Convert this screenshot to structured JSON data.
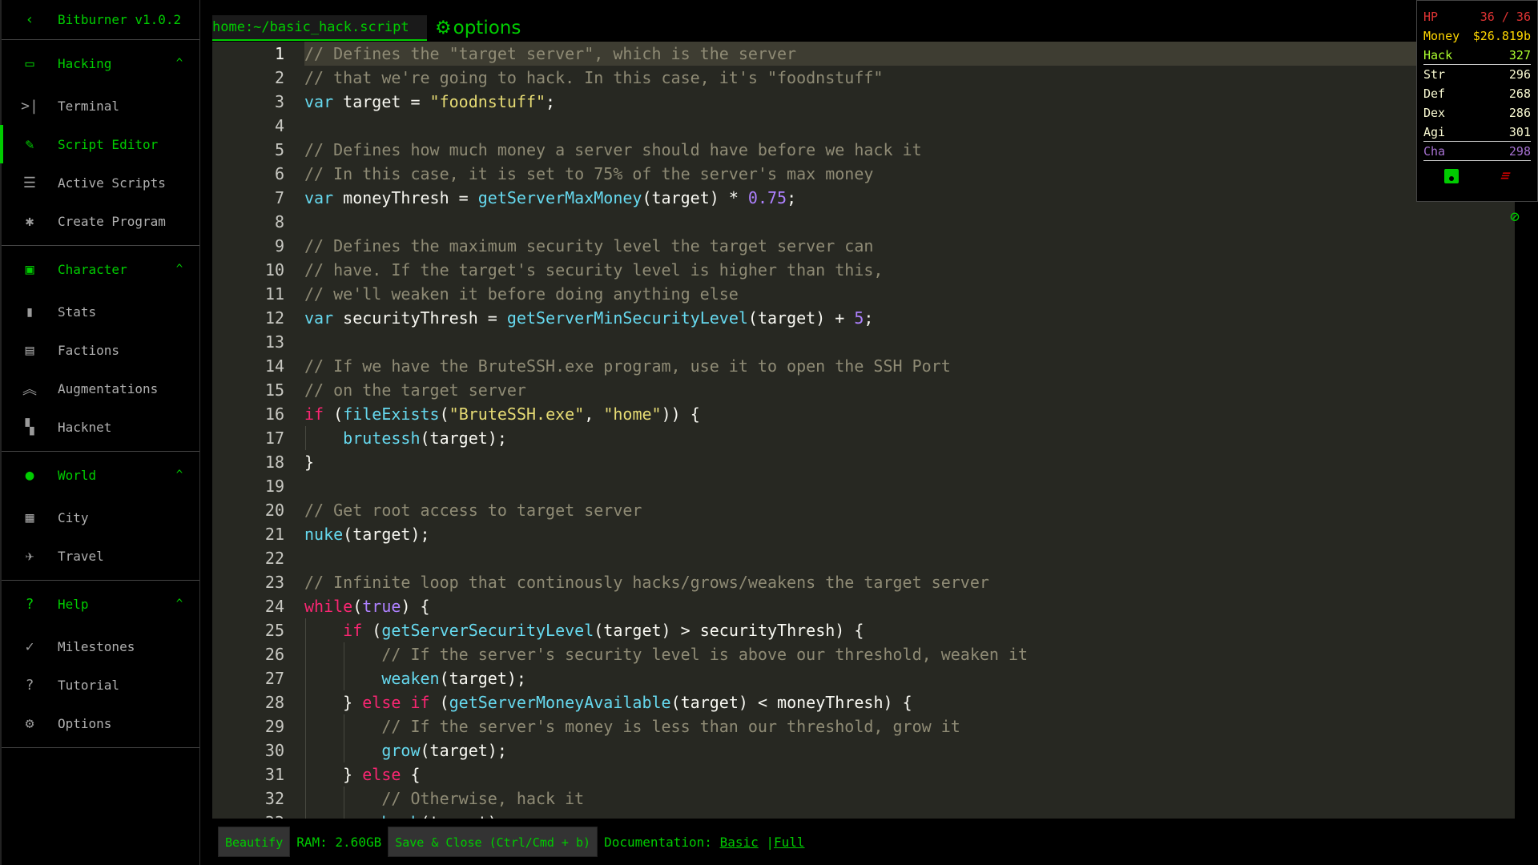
{
  "app": {
    "title": "Bitburner v1.0.2",
    "accent": "#00cc00"
  },
  "sidebar": {
    "sections": [
      {
        "label": "Hacking",
        "icon": "laptop-icon",
        "items": [
          {
            "label": "Terminal",
            "icon": "terminal-icon"
          },
          {
            "label": "Script Editor",
            "icon": "pencil-icon",
            "active": true
          },
          {
            "label": "Active Scripts",
            "icon": "list-icon"
          },
          {
            "label": "Create Program",
            "icon": "bug-icon"
          }
        ]
      },
      {
        "label": "Character",
        "icon": "account-box-icon",
        "items": [
          {
            "label": "Stats",
            "icon": "bar-chart-icon"
          },
          {
            "label": "Factions",
            "icon": "contacts-icon"
          },
          {
            "label": "Augmentations",
            "icon": "double-arrow-up-icon"
          },
          {
            "label": "Hacknet",
            "icon": "tree-icon"
          }
        ]
      },
      {
        "label": "World",
        "icon": "globe-icon",
        "items": [
          {
            "label": "City",
            "icon": "city-icon"
          },
          {
            "label": "Travel",
            "icon": "airplane-icon"
          }
        ]
      },
      {
        "label": "Help",
        "icon": "live-help-icon",
        "items": [
          {
            "label": "Milestones",
            "icon": "check-icon"
          },
          {
            "label": "Tutorial",
            "icon": "help-circle-icon"
          },
          {
            "label": "Options",
            "icon": "gear-icon"
          }
        ]
      }
    ]
  },
  "editor": {
    "tab": "home:~/basic_hack.script",
    "options_label": "options",
    "lines": [
      [
        [
          "c",
          "// Defines the \"target server\", which is the server"
        ]
      ],
      [
        [
          "c",
          "// that we're going to hack. In this case, it's \"foodnstuff\""
        ]
      ],
      [
        [
          "k",
          "var"
        ],
        [
          "",
          "target = "
        ],
        [
          "s",
          "\"foodnstuff\""
        ],
        [
          "",
          ";"
        ]
      ],
      [],
      [
        [
          "c",
          "// Defines how much money a server should have before we hack it"
        ]
      ],
      [
        [
          "c",
          "// In this case, it is set to 75% of the server's max money"
        ]
      ],
      [
        [
          "k",
          "var"
        ],
        [
          "",
          " moneyThresh = "
        ],
        [
          "f",
          "getServerMaxMoney"
        ],
        [
          "",
          "(target) * "
        ],
        [
          "n",
          "0.75"
        ],
        [
          "",
          ";"
        ]
      ],
      [],
      [
        [
          "c",
          "// Defines the maximum security level the target server can"
        ]
      ],
      [
        [
          "c",
          "// have. If the target's security level is higher than this,"
        ]
      ],
      [
        [
          "c",
          "// we'll weaken it before doing anything else"
        ]
      ],
      [
        [
          "k",
          "var"
        ],
        [
          "",
          " securityThresh = "
        ],
        [
          "f",
          "getServerMinSecurityLevel"
        ],
        [
          "",
          "(target) + "
        ],
        [
          "n",
          "5"
        ],
        [
          "",
          ";"
        ]
      ],
      [],
      [
        [
          "c",
          "// If we have the BruteSSH.exe program, use it to open the SSH Port"
        ]
      ],
      [
        [
          "c",
          "// on the target server"
        ]
      ],
      [
        [
          "p",
          "if"
        ],
        [
          "",
          " ("
        ],
        [
          "f",
          "fileExists"
        ],
        [
          "",
          "("
        ],
        [
          "s",
          "\"BruteSSH.exe\""
        ],
        [
          "",
          ", "
        ],
        [
          "s",
          "\"home\""
        ],
        [
          "",
          ")) {"
        ]
      ],
      [
        [
          "",
          "    "
        ],
        [
          "f",
          "brutessh"
        ],
        [
          "",
          "(target);"
        ]
      ],
      [
        [
          "",
          "}"
        ]
      ],
      [],
      [
        [
          "c",
          "// Get root access to target server"
        ]
      ],
      [
        [
          "f",
          "nuke"
        ],
        [
          "",
          "(target);"
        ]
      ],
      [],
      [
        [
          "c",
          "// Infinite loop that continously hacks/grows/weakens the target server"
        ]
      ],
      [
        [
          "p",
          "while"
        ],
        [
          "",
          "("
        ],
        [
          "n",
          "true"
        ],
        [
          "",
          ") {"
        ]
      ],
      [
        [
          "",
          "    "
        ],
        [
          "p",
          "if"
        ],
        [
          "",
          " ("
        ],
        [
          "f",
          "getServerSecurityLevel"
        ],
        [
          "",
          "(target) > securityThresh) {"
        ]
      ],
      [
        [
          "",
          "        "
        ],
        [
          "c",
          "// If the server's security level is above our threshold, weaken it"
        ]
      ],
      [
        [
          "",
          "        "
        ],
        [
          "f",
          "weaken"
        ],
        [
          "",
          "(target);"
        ]
      ],
      [
        [
          "",
          "    } "
        ],
        [
          "p",
          "else if"
        ],
        [
          "",
          " ("
        ],
        [
          "f",
          "getServerMoneyAvailable"
        ],
        [
          "",
          "(target) < moneyThresh) {"
        ]
      ],
      [
        [
          "",
          "        "
        ],
        [
          "c",
          "// If the server's money is less than our threshold, grow it"
        ]
      ],
      [
        [
          "",
          "        "
        ],
        [
          "f",
          "grow"
        ],
        [
          "",
          "(target);"
        ]
      ],
      [
        [
          "",
          "    } "
        ],
        [
          "p",
          "else"
        ],
        [
          "",
          " {"
        ]
      ],
      [
        [
          "",
          "        "
        ],
        [
          "c",
          "// Otherwise, hack it"
        ]
      ],
      [
        [
          "",
          "        "
        ],
        [
          "f",
          "hack"
        ],
        [
          "",
          "(target);"
        ]
      ]
    ]
  },
  "bottombar": {
    "beautify": "Beautify",
    "ram": "RAM: 2.60GB",
    "save_close": "Save & Close (Ctrl/Cmd + b)",
    "doc_label": "Documentation:",
    "doc_basic": "Basic",
    "doc_sep": "|",
    "doc_full": "Full"
  },
  "overlay": {
    "stats": [
      {
        "label": "HP",
        "value": "36 / 36",
        "color": "#dd3333"
      },
      {
        "label": "Money",
        "value": "$26.819b",
        "color": "#ffd700"
      },
      {
        "label": "Hack",
        "value": "327",
        "color": "#adff2f",
        "sep": true
      },
      {
        "label": "Str",
        "value": "296",
        "color": "#fafad2"
      },
      {
        "label": "Def",
        "value": "268",
        "color": "#fafad2"
      },
      {
        "label": "Dex",
        "value": "286",
        "color": "#fafad2"
      },
      {
        "label": "Agi",
        "value": "301",
        "color": "#fafad2",
        "sep": true
      },
      {
        "label": "Cha",
        "value": "298",
        "color": "#a671d1",
        "sep": true
      }
    ],
    "save_icon": "save-icon",
    "kill_icon": "kill-all-icon",
    "hide_icon": "eye-off-icon"
  }
}
